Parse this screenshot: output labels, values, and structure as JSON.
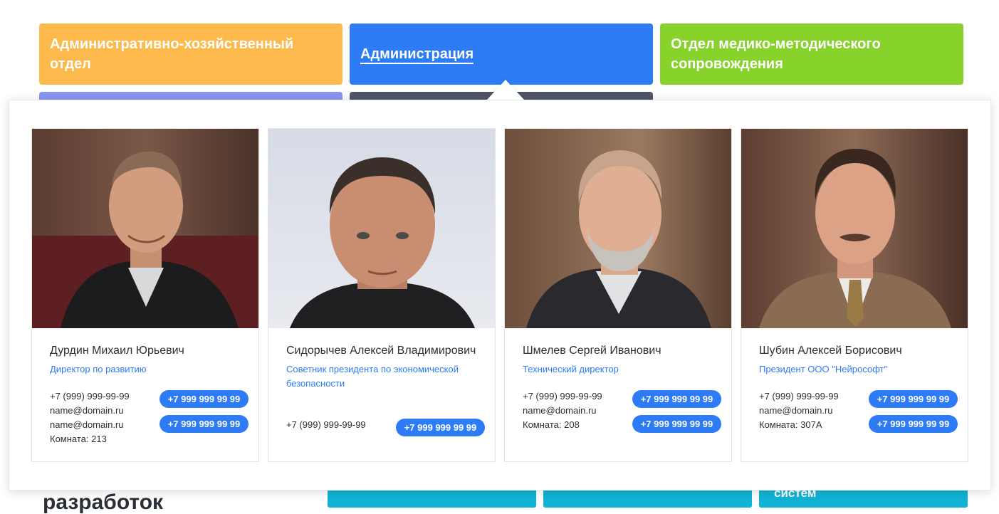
{
  "departments": {
    "ahz": "Административно-хозяйственный отдел",
    "admin": "Администрация",
    "med": "Отдел медико-методического сопровождения"
  },
  "bottom": {
    "title": "разработок",
    "tile3": "систем"
  },
  "staff": [
    {
      "name": "Дурдин Михаил Юрьевич",
      "role": "Директор по развитию",
      "info": [
        "+7 (999) 999-99-99",
        "name@domain.ru",
        "name@domain.ru",
        "Комната: 213"
      ],
      "buttons": [
        "+7 999 999 99 99",
        "+7 999 999 99 99"
      ]
    },
    {
      "name": "Сидорычев Алексей Владимирович",
      "role": "Советник президента по экономической безопасности",
      "info": [
        "+7 (999) 999-99-99"
      ],
      "buttons": [
        "+7 999 999 99 99"
      ]
    },
    {
      "name": "Шмелев Сергей Иванович",
      "role": "Технический директор",
      "info": [
        "+7 (999) 999-99-99",
        "name@domain.ru",
        "Комната: 208"
      ],
      "buttons": [
        "+7 999 999 99 99",
        "+7 999 999 99 99"
      ]
    },
    {
      "name": "Шубин Алексей Борисович",
      "role": "Президент ООО \"Нейрософт\"",
      "info": [
        "+7 (999) 999-99-99",
        "name@domain.ru",
        "Комната: 307А"
      ],
      "buttons": [
        "+7 999 999 99 99",
        "+7 999 999 99 99"
      ]
    }
  ],
  "colors": {
    "accent": "#2d7bf5",
    "tile_orange": "#fdb94b",
    "tile_green": "#87d22b",
    "tile_violet": "#8a96f2",
    "tile_dark": "#4f5666",
    "tile_cyan": "#11b3d6"
  }
}
